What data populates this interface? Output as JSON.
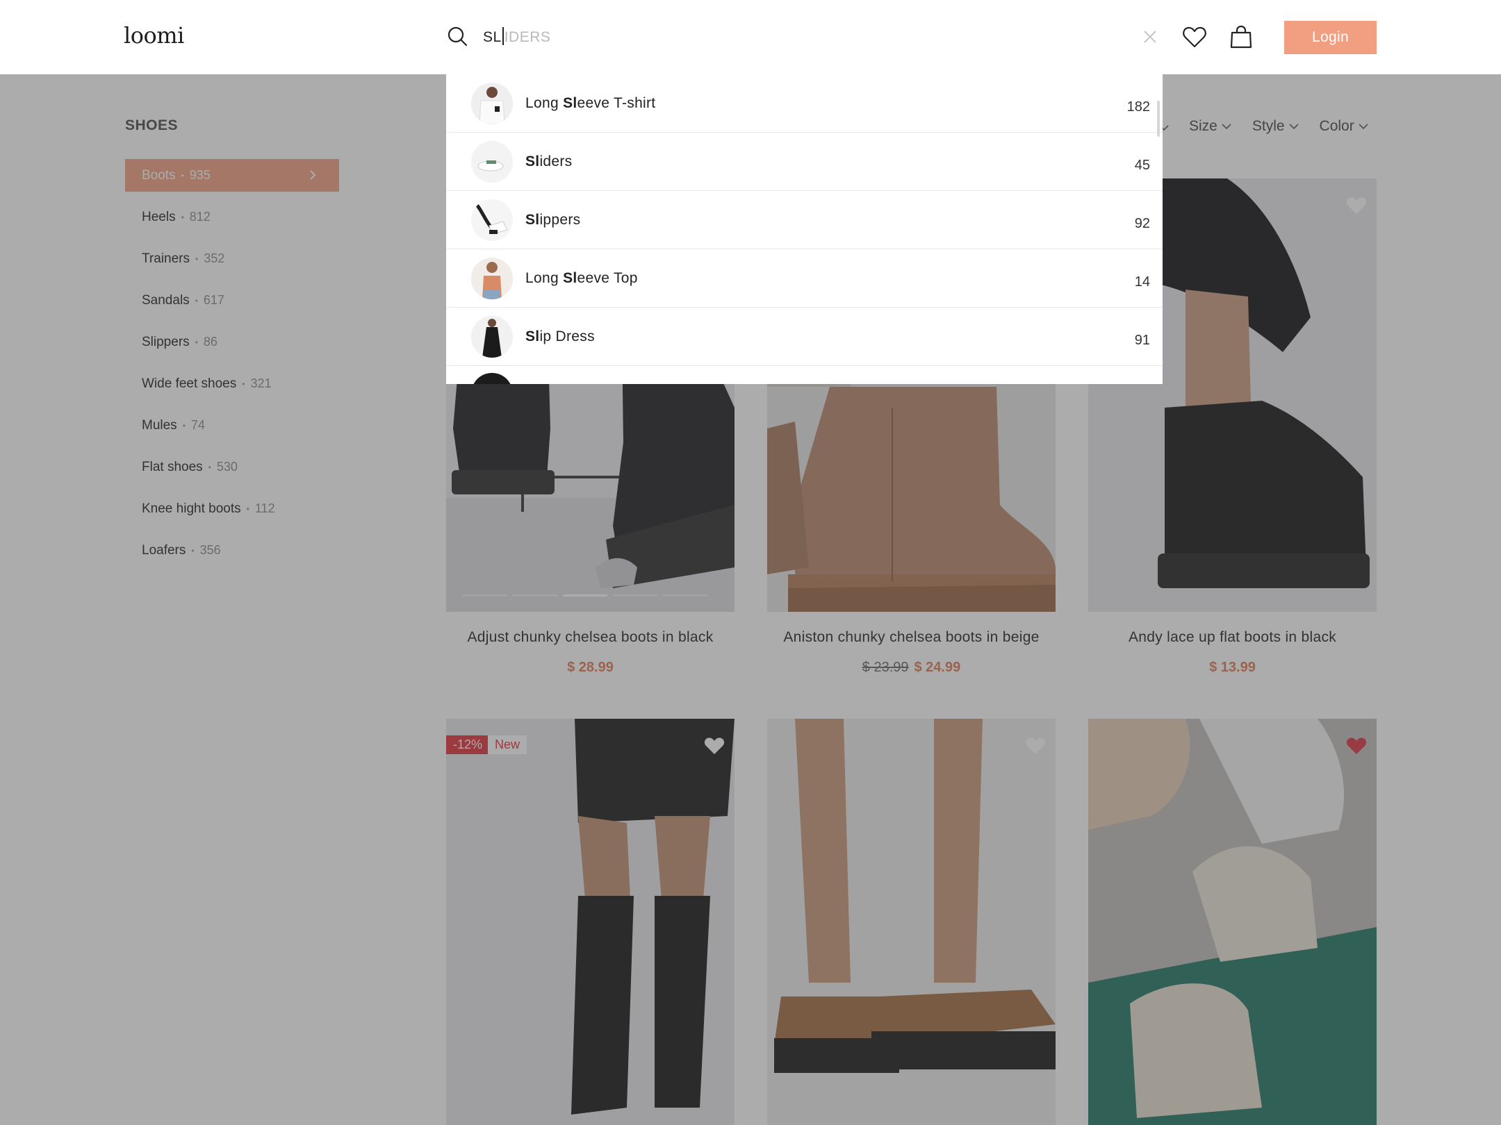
{
  "header": {
    "logo": "loomi",
    "search_typed": "SL",
    "search_suggestion": "IDERS",
    "login_label": "Login"
  },
  "sidebar": {
    "title": "SHOES",
    "items": [
      {
        "label": "Boots",
        "count": "935",
        "active": true
      },
      {
        "label": "Heels",
        "count": "812"
      },
      {
        "label": "Trainers",
        "count": "352"
      },
      {
        "label": "Sandals",
        "count": "617"
      },
      {
        "label": "Slippers",
        "count": "86"
      },
      {
        "label": "Wide feet shoes",
        "count": "321"
      },
      {
        "label": "Mules",
        "count": "74"
      },
      {
        "label": "Flat shoes",
        "count": "530"
      },
      {
        "label": "Knee hight boots",
        "count": "112"
      },
      {
        "label": "Loafers",
        "count": "356"
      }
    ]
  },
  "filters": [
    {
      "label": "Size"
    },
    {
      "label": "Style"
    },
    {
      "label": "Color"
    }
  ],
  "products": [
    {
      "name": "Adjust chunky chelsea boots in black",
      "price": "$ 28.99",
      "old_price": ""
    },
    {
      "name": "Aniston chunky chelsea boots in beige",
      "price": "$ 24.99",
      "old_price": "$ 23.99"
    },
    {
      "name": "Andy lace up flat boots in black",
      "price": "$ 13.99",
      "old_price": ""
    },
    {
      "name": "",
      "badge_sale": "-12%",
      "badge_new": "New"
    },
    {
      "name": ""
    },
    {
      "name": "",
      "favorited": true
    }
  ],
  "search_dropdown": {
    "items": [
      {
        "pre": "Long ",
        "bold": "Sl",
        "post": "eeve T-shirt",
        "count": "182",
        "thumb": "tshirt"
      },
      {
        "pre": "",
        "bold": "Sl",
        "post": "iders",
        "count": "45",
        "thumb": "sliders"
      },
      {
        "pre": "",
        "bold": "Sl",
        "post": "ippers",
        "count": "92",
        "thumb": "slippers"
      },
      {
        "pre": "Long ",
        "bold": "Sl",
        "post": "eeve Top",
        "count": "14",
        "thumb": "top"
      },
      {
        "pre": "",
        "bold": "Sl",
        "post": "ip Dress",
        "count": "91",
        "thumb": "dress"
      }
    ]
  },
  "colors": {
    "accent": "#f19f80",
    "price": "#e07a54",
    "sale_badge": "#e0303a",
    "heart_active": "#d9343f"
  }
}
